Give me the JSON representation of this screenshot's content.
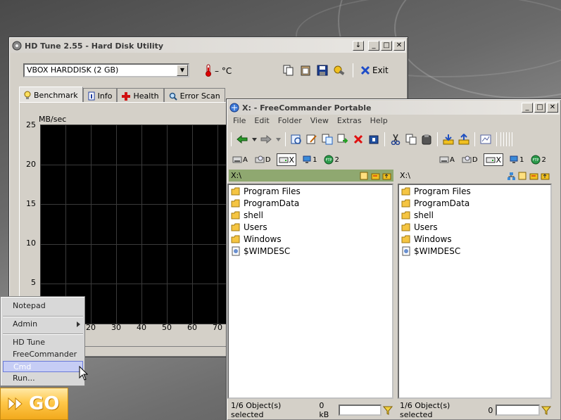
{
  "hdtune": {
    "title": "HD Tune 2.55 - Hard Disk Utility",
    "disk_select": "VBOX HARDDISK (2 GB)",
    "temperature": "– °C",
    "exit_label": "Exit",
    "tabs": [
      {
        "label": "Benchmark",
        "icon": "bulb-icon"
      },
      {
        "label": "Info",
        "icon": "info-icon"
      },
      {
        "label": "Health",
        "icon": "health-cross-icon"
      },
      {
        "label": "Error Scan",
        "icon": "magnifier-icon"
      }
    ],
    "chart": {
      "ylabel": "MB/sec",
      "yticks": [
        "25",
        "20",
        "15",
        "10",
        "5"
      ],
      "xticks": [
        "20",
        "30",
        "40",
        "50",
        "60",
        "70"
      ]
    }
  },
  "freecommander": {
    "title": "X: - FreeCommander  Portable",
    "menu": [
      "File",
      "Edit",
      "Folder",
      "View",
      "Extras",
      "Help"
    ],
    "drives_left": [
      {
        "label": "A",
        "icon": "floppy-drive-icon"
      },
      {
        "label": "D",
        "icon": "cd-drive-icon"
      },
      {
        "label": "X",
        "icon": "hard-drive-icon",
        "selected": true
      },
      {
        "label": "1",
        "icon": "network-drive-icon"
      },
      {
        "label": "2",
        "icon": "ftp-icon"
      }
    ],
    "drives_right": [
      {
        "label": "A",
        "icon": "floppy-drive-icon"
      },
      {
        "label": "D",
        "icon": "cd-drive-icon"
      },
      {
        "label": "X",
        "icon": "hard-drive-icon",
        "selected": true
      },
      {
        "label": "1",
        "icon": "network-drive-icon"
      },
      {
        "label": "2",
        "icon": "ftp-icon"
      }
    ],
    "left_pane": {
      "path": "X:\\",
      "items": [
        {
          "name": "Program Files",
          "type": "folder"
        },
        {
          "name": "ProgramData",
          "type": "folder"
        },
        {
          "name": "shell",
          "type": "folder"
        },
        {
          "name": "Users",
          "type": "folder"
        },
        {
          "name": "Windows",
          "type": "folder"
        },
        {
          "name": "$WIMDESC",
          "type": "file"
        }
      ],
      "status": "1/6 Object(s) selected",
      "size": "0 kB"
    },
    "right_pane": {
      "path": "X:\\",
      "items": [
        {
          "name": "Program Files",
          "type": "folder"
        },
        {
          "name": "ProgramData",
          "type": "folder"
        },
        {
          "name": "shell",
          "type": "folder"
        },
        {
          "name": "Users",
          "type": "folder"
        },
        {
          "name": "Windows",
          "type": "folder"
        },
        {
          "name": "$WIMDESC",
          "type": "file"
        }
      ],
      "status": "1/6 Object(s) selected",
      "size": "0"
    }
  },
  "popup_menu": {
    "items": [
      {
        "label": "Notepad"
      },
      {
        "label": "Admin",
        "submenu": true
      },
      {
        "label": "HD Tune"
      },
      {
        "label": "FreeCommander"
      },
      {
        "label": "Cmd",
        "highlighted": true
      },
      {
        "label": "Run..."
      }
    ]
  },
  "go_button": {
    "label": "GO"
  },
  "colors": {
    "active_path_bar": "#8fa870",
    "menu_highlight": "#c6cdf5",
    "go_orange": "#f2a91c"
  }
}
